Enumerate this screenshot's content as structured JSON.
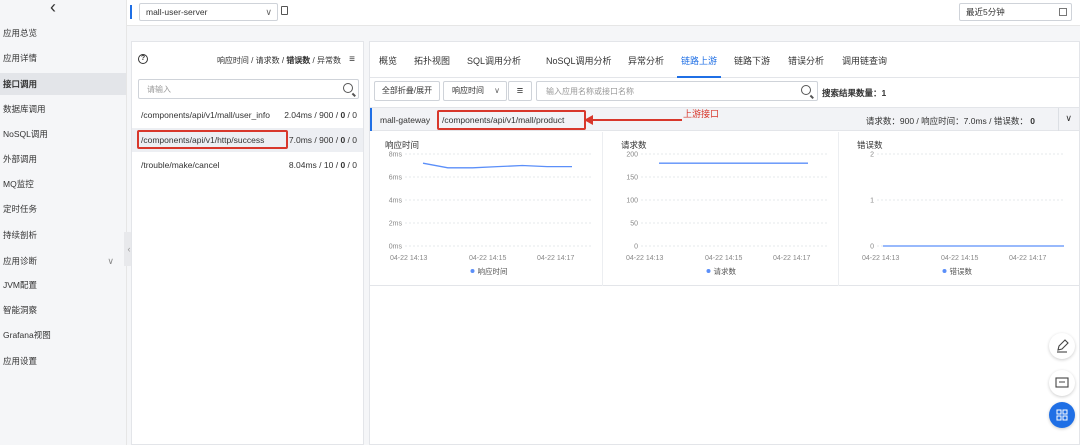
{
  "topbar": {
    "app_name": "mall-user-server",
    "time_range": "最近5分钟"
  },
  "sidebar": {
    "items": [
      {
        "label": "应用总览"
      },
      {
        "label": "应用详情"
      },
      {
        "label": "接口调用",
        "active": true
      },
      {
        "label": "数据库调用"
      },
      {
        "label": "NoSQL调用"
      },
      {
        "label": "外部调用"
      },
      {
        "label": "MQ监控"
      },
      {
        "label": "定时任务"
      },
      {
        "label": "持续剖析"
      },
      {
        "label": "应用诊断",
        "expandable": true
      },
      {
        "label": "JVM配置"
      },
      {
        "label": "智能洞察"
      },
      {
        "label": "Grafana视图"
      },
      {
        "label": "应用设置"
      }
    ]
  },
  "list_panel": {
    "sort_labels": {
      "response_time": "响应时间",
      "requests": "请求数",
      "errors": "错误数",
      "exceptions": "异常数"
    },
    "search_placeholder": "请输入",
    "rows": [
      {
        "path": "/components/api/v1/mall/user_info",
        "time": "2.04ms",
        "count": "900",
        "errors": "0",
        "exceptions": "0"
      },
      {
        "path": "/components/api/v1/http/success",
        "time": "7.0ms",
        "count": "900",
        "errors": "0",
        "exceptions": "0"
      },
      {
        "path": "/trouble/make/cancel",
        "time": "8.04ms",
        "count": "10",
        "errors": "0",
        "exceptions": "0"
      }
    ]
  },
  "main": {
    "tabs": [
      "概览",
      "拓扑视图",
      "SQL调用分析",
      "NoSQL调用分析",
      "异常分析",
      "链路上游",
      "链路下游",
      "错误分析",
      "调用链查询"
    ],
    "active_tab": "链路上游",
    "toggle_all_label": "全部折叠/展开",
    "sort_select": "响应时间",
    "search_placeholder": "输入应用名称或接口名称",
    "result_count": "搜索结果数量：1",
    "trace": {
      "service": "mall-gateway",
      "interface": "/components/api/v1/mall/product",
      "summary": "请求数：900 / 响应时间：7.0ms / 错误数：",
      "summary_errors": "0"
    },
    "annotation": "上游接口"
  },
  "colors": {
    "accent": "#1f6fe5",
    "highlight": "#d8372b",
    "series": "#5b8ff9"
  },
  "chart_data": [
    {
      "type": "line",
      "title": "响应时间",
      "x": [
        "04-22 14:13",
        "04-22 14:15",
        "04-22 14:17"
      ],
      "ytick_labels": [
        "0ms",
        "2ms",
        "4ms",
        "6ms",
        "8ms"
      ],
      "ylim": [
        0,
        8
      ],
      "series": [
        {
          "name": "响应时间",
          "values": [
            7.2,
            6.8,
            6.8,
            6.9,
            7.0,
            6.9,
            6.9
          ]
        }
      ]
    },
    {
      "type": "line",
      "title": "请求数",
      "x": [
        "04-22 14:13",
        "04-22 14:15",
        "04-22 14:17"
      ],
      "ytick_labels": [
        "0",
        "50",
        "100",
        "150",
        "200"
      ],
      "ylim": [
        0,
        200
      ],
      "series": [
        {
          "name": "请求数",
          "values": [
            180,
            180,
            180,
            180,
            180,
            180,
            180
          ]
        }
      ]
    },
    {
      "type": "line",
      "title": "错误数",
      "x": [
        "04-22 14:13",
        "04-22 14:15",
        "04-22 14:17"
      ],
      "ytick_labels": [
        "0",
        "1",
        "2"
      ],
      "ylim": [
        0,
        2
      ],
      "series": [
        {
          "name": "错误数",
          "values": [
            0,
            0,
            0,
            0,
            0,
            0,
            0
          ]
        }
      ]
    }
  ]
}
